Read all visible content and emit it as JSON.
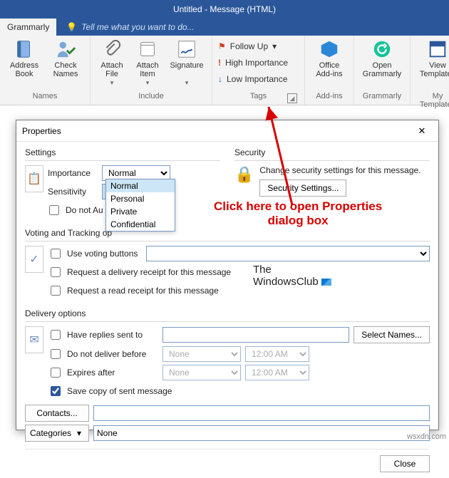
{
  "titlebar": {
    "text": "Untitled - Message (HTML)"
  },
  "tellme": {
    "tab": "Grammarly",
    "hint": "Tell me what you want to do..."
  },
  "ribbon": {
    "names": {
      "addressbook": "Address\nBook",
      "checknames": "Check\nNames",
      "attachfile": "Attach\nFile",
      "attachitem": "Attach\nItem",
      "signature": "Signature",
      "followup": "Follow Up",
      "high": "High Importance",
      "low": "Low Importance",
      "addins": "Office\nAdd-ins",
      "grammarly": "Open\nGrammarly",
      "templates": "View\nTemplates"
    },
    "groups": {
      "names": "Names",
      "include": "Include",
      "tags": "Tags",
      "addins": "Add-ins",
      "grammarly": "Grammarly",
      "templates": "My Templates"
    }
  },
  "dialog": {
    "title": "Properties",
    "close": "Close",
    "settings": {
      "title": "Settings",
      "importance": "Importance",
      "importance_val": "Normal",
      "sensitivity": "Sensitivity",
      "sensitivity_val": "Normal",
      "options": [
        "Normal",
        "Personal",
        "Private",
        "Confidential"
      ],
      "autoarchive": "Do not AutoArchive this item"
    },
    "security": {
      "title": "Security",
      "text": "Change security settings for this message.",
      "button": "Security Settings..."
    },
    "voting": {
      "title": "Voting and Tracking options",
      "use": "Use voting buttons",
      "delivery": "Request a delivery receipt for this message",
      "read": "Request a read receipt for this message"
    },
    "delivery": {
      "title": "Delivery options",
      "replies": "Have replies sent to",
      "selectnames": "Select Names...",
      "notbefore": "Do not deliver before",
      "expires": "Expires after",
      "none": "None",
      "time": "12:00 AM",
      "savecopy": "Save copy of sent message",
      "contacts": "Contacts...",
      "categories": "Categories",
      "categories_val": "None"
    }
  },
  "annotation": {
    "line1": "Click here to open Properties",
    "line2": "dialog box"
  },
  "watermark": {
    "l1": "The",
    "l2": "WindowsClub"
  },
  "credit": "wsxdn.com"
}
